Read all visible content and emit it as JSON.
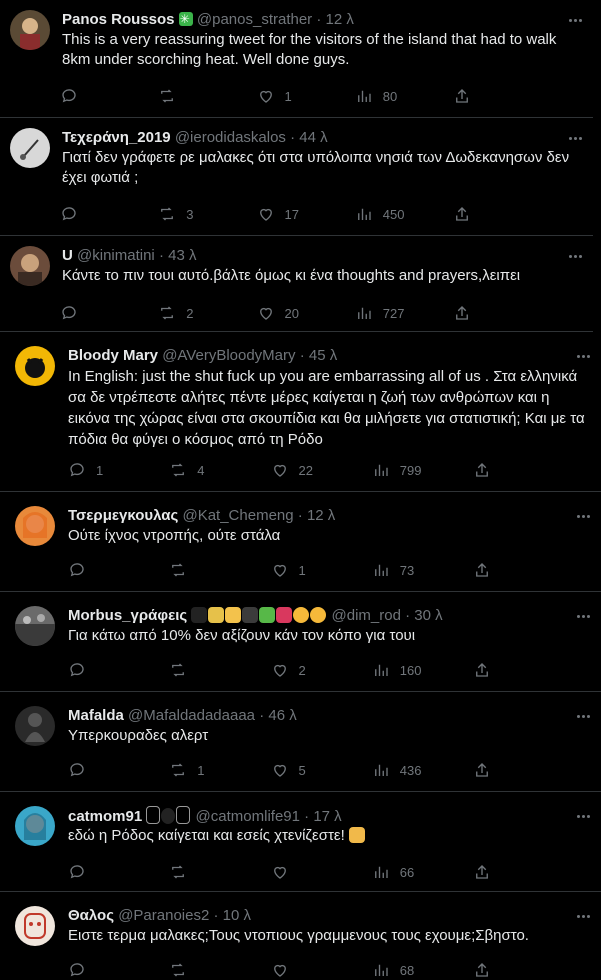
{
  "tweets": [
    {
      "name": "Panos Roussos",
      "handle": "@panos_strather",
      "sep": "·",
      "time": "12 λ",
      "text": "This is a very reassuring tweet for the visitors of the island that had to walk 8km under scorching heat. Well done guys.",
      "replies": "",
      "retweets": "",
      "likes": "1",
      "views": "80",
      "avatar_color": "#5a4a35"
    },
    {
      "name": "Τεχεράνη_2019",
      "handle": "@ierodidaskalos",
      "sep": "·",
      "time": "44 λ",
      "text": "Γιατί δεν γράφετε ρε μαλακες ότι στα υπόλοιπα νησιά των Δωδεκανησων δεν έχει φωτιά ;",
      "replies": "",
      "retweets": "3",
      "likes": "17",
      "views": "450",
      "avatar_color": "#d8d8d8"
    },
    {
      "name": "U",
      "handle": "@kinimatini",
      "sep": "·",
      "time": "43 λ",
      "text": "Κάντε το πιν τουι αυτό.βάλτε όμως κι ένα thoughts and prayers,λειπει",
      "replies": "",
      "retweets": "2",
      "likes": "20",
      "views": "727",
      "avatar_color": "#6b4c3b"
    },
    {
      "name": "Bloody Mary",
      "handle": "@AVeryBloodyMary",
      "sep": "·",
      "time": "45 λ",
      "text": "In English: just the shut fuck up you are embarrassing all of us . Στα ελληνικά σα δε ντρέπεστε αλήτες πέντε μέρες καίγεται η ζωή των ανθρώπων και η εικόνα της χώρας είναι στα σκουπίδια και θα μιλήσετε για στατιστική; Και με τα πόδια θα φύγει ο κόσμος από τη Ρόδο",
      "replies": "1",
      "retweets": "4",
      "likes": "22",
      "views": "799",
      "avatar_color": "#f2b705"
    },
    {
      "name": "Τσερμεγκουλας",
      "handle": "@Kat_Chemeng",
      "sep": "·",
      "time": "12 λ",
      "text": "Ούτε ίχνος ντροπής, ούτε στάλα",
      "replies": "",
      "retweets": "",
      "likes": "1",
      "views": "73",
      "avatar_color": "#e8893a"
    },
    {
      "name": "Morbus_γράφεις",
      "handle": "@dim_rod",
      "sep": "·",
      "time": "30 λ",
      "text": "Για κάτω από 10% δεν αξίζουν κάν τον κόπο για τουι",
      "replies": "",
      "retweets": "",
      "likes": "2",
      "views": "160",
      "avatar_color": "#6a6a6a"
    },
    {
      "name": "Mafalda",
      "handle": "@Mafaldadadaaaa",
      "sep": "·",
      "time": "46 λ",
      "text": "Υπερκουραδες αλερτ",
      "replies": "",
      "retweets": "1",
      "likes": "5",
      "views": "436",
      "avatar_color": "#2a2a2a"
    },
    {
      "name": "catmom91",
      "handle": "@catmomlife91",
      "sep": "·",
      "time": "17 λ",
      "text": "εδώ η Ρόδος καίγεται και εσείς χτενίζεστε!",
      "replies": "",
      "retweets": "",
      "likes": "",
      "views": "66",
      "avatar_color": "#3aa7c9"
    },
    {
      "name": "Θαλος",
      "handle": "@Paranoies2",
      "sep": "·",
      "time": "10 λ",
      "text": "Ειστε τερμα μαλακες;Τους ντοπιους γραμμενους τους εχουμε;Σβηστο.",
      "replies": "",
      "retweets": "",
      "likes": "",
      "views": "68",
      "avatar_color": "#f0e6dd"
    }
  ]
}
